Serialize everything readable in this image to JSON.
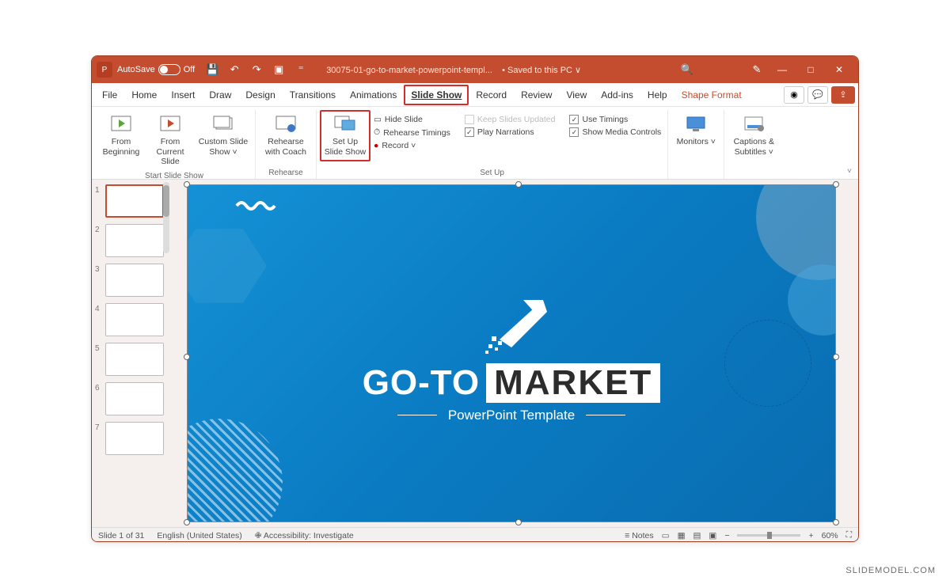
{
  "titlebar": {
    "autosave_label": "AutoSave",
    "autosave_state": "Off",
    "filename": "30075-01-go-to-market-powerpoint-templ...",
    "saved_status": "• Saved to this PC ∨"
  },
  "menu": {
    "tabs": [
      "File",
      "Home",
      "Insert",
      "Draw",
      "Design",
      "Transitions",
      "Animations",
      "Slide Show",
      "Record",
      "Review",
      "View",
      "Add-ins",
      "Help",
      "Shape Format"
    ],
    "active": "Slide Show"
  },
  "ribbon": {
    "start": {
      "label": "Start Slide Show",
      "from_beginning": "From Beginning",
      "from_current": "From Current Slide",
      "custom": "Custom Slide Show ˅"
    },
    "rehearse": {
      "label": "Rehearse",
      "coach": "Rehearse with Coach"
    },
    "setup": {
      "label": "Set Up",
      "setup_btn": "Set Up Slide Show",
      "hide": "Hide Slide",
      "rehearse_timings": "Rehearse Timings",
      "record": "Record ˅",
      "keep_updated": "Keep Slides Updated",
      "play_narrations": "Play Narrations",
      "use_timings": "Use Timings",
      "show_media": "Show Media Controls"
    },
    "monitors": {
      "label": "Monitors ˅"
    },
    "captions": {
      "label": "Captions & Subtitles ˅"
    }
  },
  "slide": {
    "title_a": "GO-TO",
    "title_b": "MARKET",
    "subtitle": "PowerPoint Template"
  },
  "thumbnails": [
    1,
    2,
    3,
    4,
    5,
    6,
    7
  ],
  "status": {
    "slide": "Slide 1 of 31",
    "lang": "English (United States)",
    "access": "Accessibility: Investigate",
    "notes": "Notes",
    "zoom": "60%"
  },
  "watermark": "SLIDEMODEL.COM"
}
